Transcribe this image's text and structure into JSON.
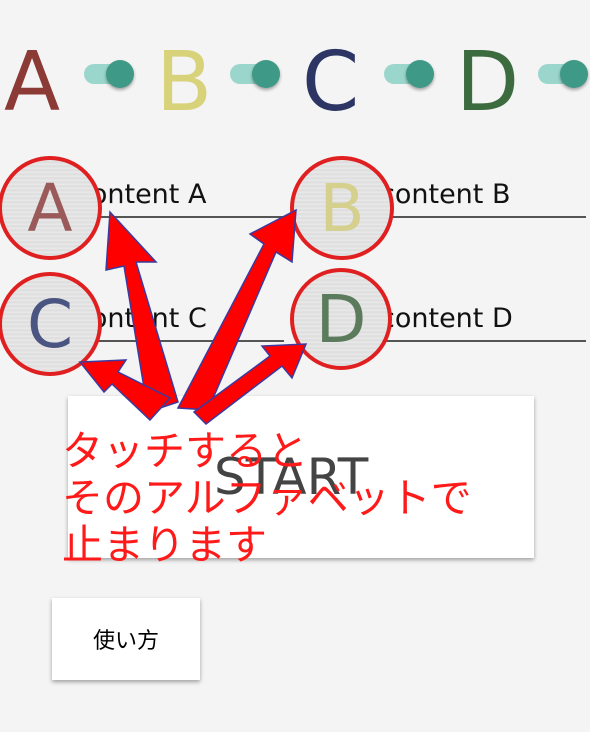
{
  "header_letters": [
    {
      "letter": "A",
      "color": "#8b3a36"
    },
    {
      "letter": "B",
      "color": "#d8d27a"
    },
    {
      "letter": "C",
      "color": "#2c3563"
    },
    {
      "letter": "D",
      "color": "#3d6b40"
    }
  ],
  "toggle_colors": {
    "track": "#9bd6cc",
    "thumb": "#3e9a87"
  },
  "fields": {
    "a": {
      "placeholder": "content A"
    },
    "b": {
      "placeholder": "content B"
    },
    "c": {
      "placeholder": "content C"
    },
    "d": {
      "placeholder": "content D"
    }
  },
  "circled_letters": {
    "a": "A",
    "b": "B",
    "c": "C",
    "d": "D"
  },
  "start_label": "START",
  "howto_label": "使い方",
  "annotation": {
    "text": "タッチすると\nそのアルファベットで\n止まります",
    "color": "#ff1a1a"
  }
}
